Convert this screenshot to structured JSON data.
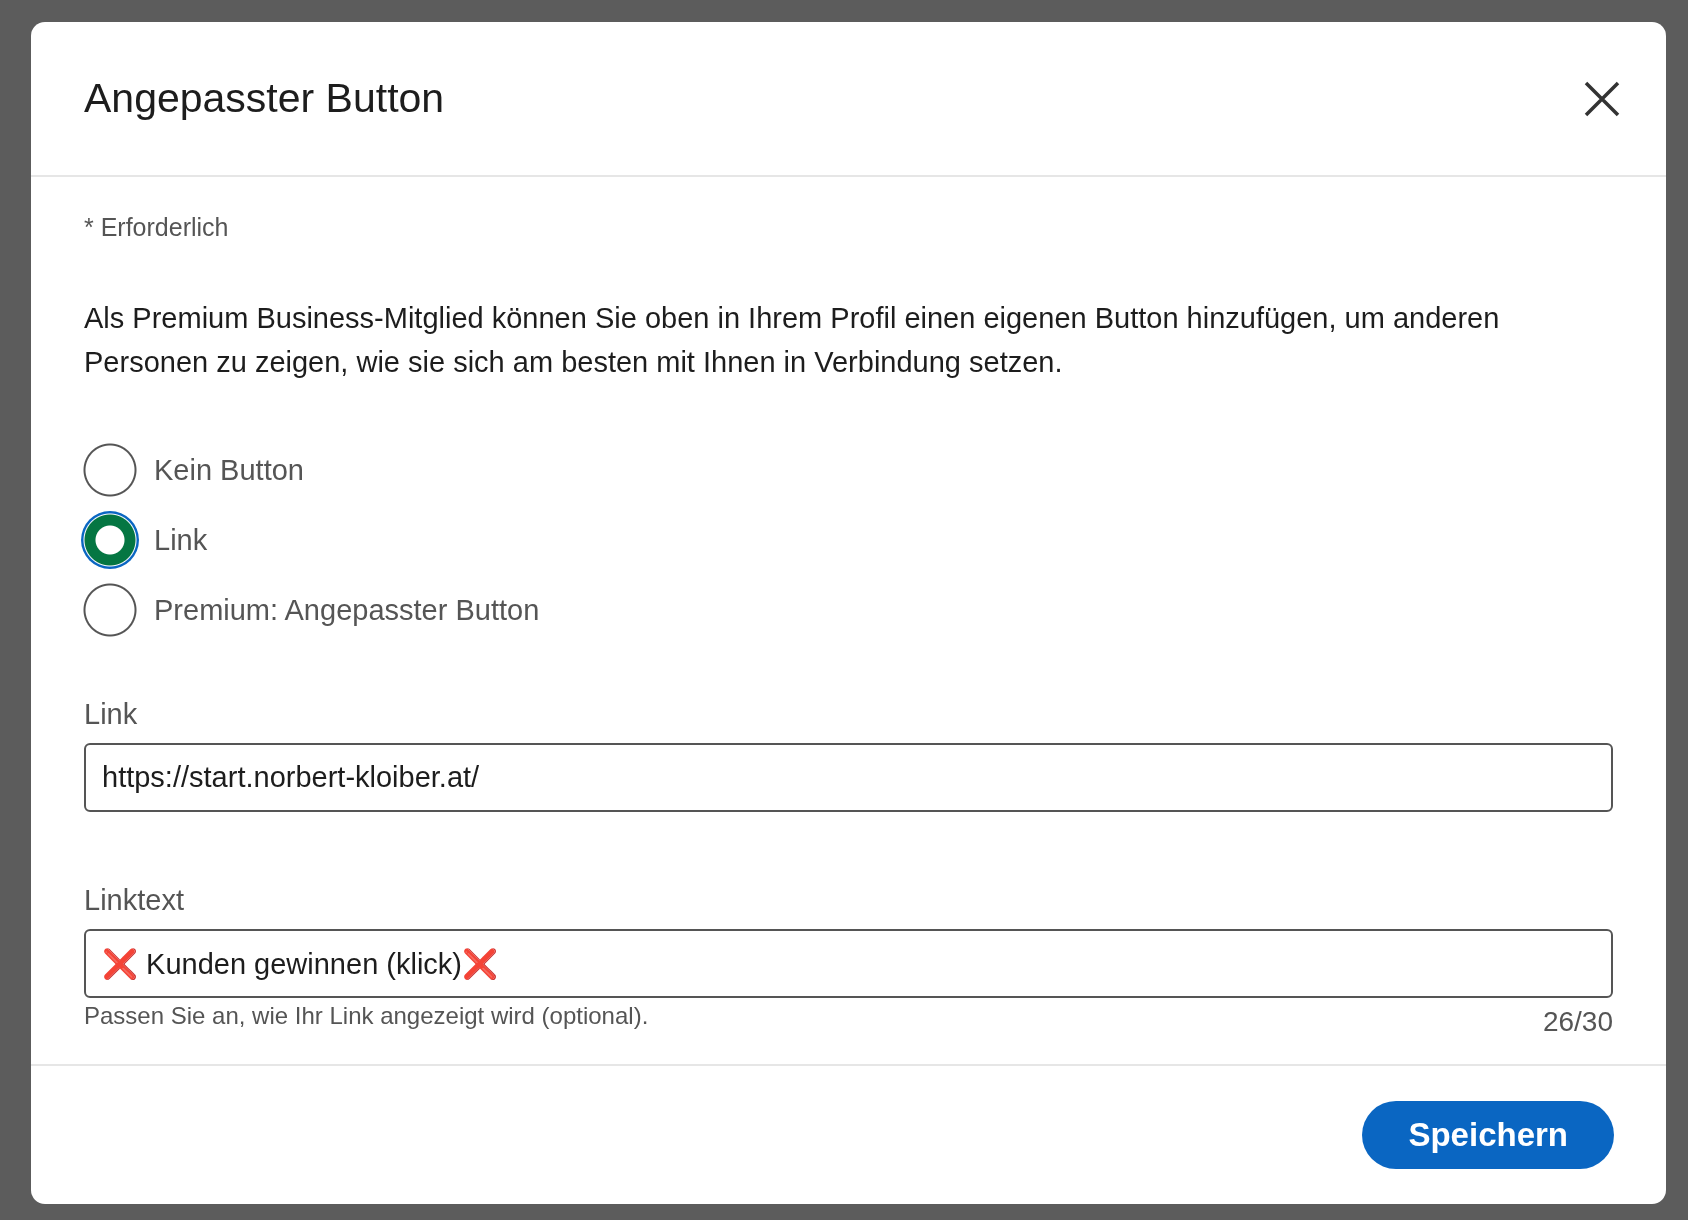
{
  "dialog": {
    "title": "Angepasster Button",
    "required_note": "* Erforderlich",
    "description": "Als Premium Business-Mitglied können Sie oben in Ihrem Profil einen eigenen Button hinzufügen, um anderen Personen zu zeigen, wie sie sich am besten mit Ihnen in Verbindung setzen.",
    "options": [
      {
        "label": "Kein Button",
        "selected": false
      },
      {
        "label": "Link",
        "selected": true
      },
      {
        "label": "Premium: Angepasster Button",
        "selected": false
      }
    ],
    "fields": [
      {
        "label": "Link",
        "value": "https://start.norbert-kloiber.at/"
      },
      {
        "label": "Linktext",
        "value": "❌ Kunden gewinnen (klick)❌",
        "hint": "Passen Sie an, wie Ihr Link angezeigt wird (optional).",
        "counter": "26/30"
      }
    ],
    "save_button": "Speichern"
  }
}
